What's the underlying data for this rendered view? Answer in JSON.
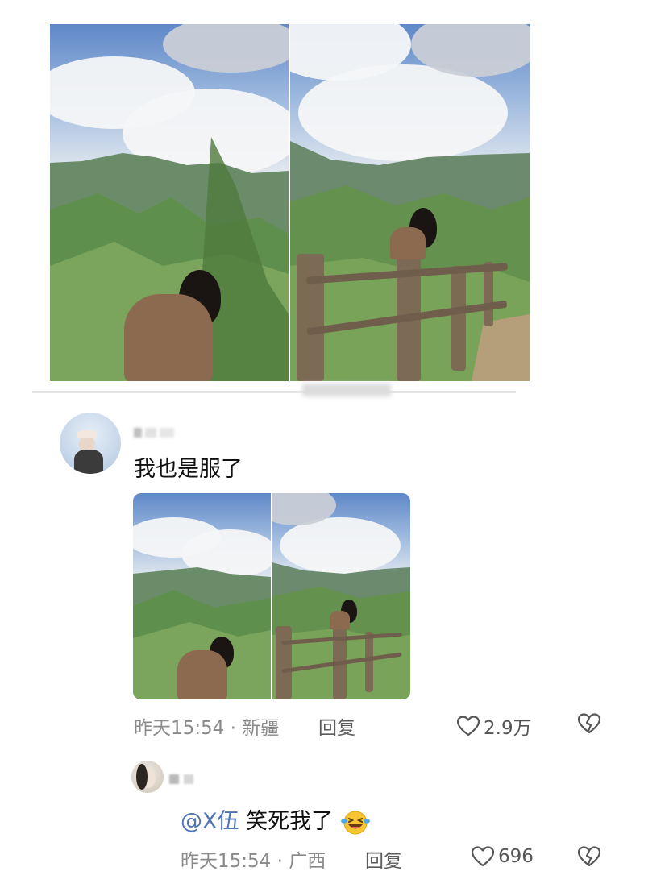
{
  "comment": {
    "text": "我也是服了",
    "meta": "昨天15:54 · 新疆",
    "reply_label": "回复",
    "like_count": "2.9万"
  },
  "reply": {
    "mention": "@X伍",
    "text": "笑死我了",
    "emoji": "laughing-with-tears-emoji",
    "meta": "昨天15:54 · 广西",
    "reply_label": "回复",
    "like_count": "696"
  },
  "colors": {
    "mention": "#4e74b7",
    "meta_text": "#8a8a8a",
    "body_text": "#111111"
  }
}
